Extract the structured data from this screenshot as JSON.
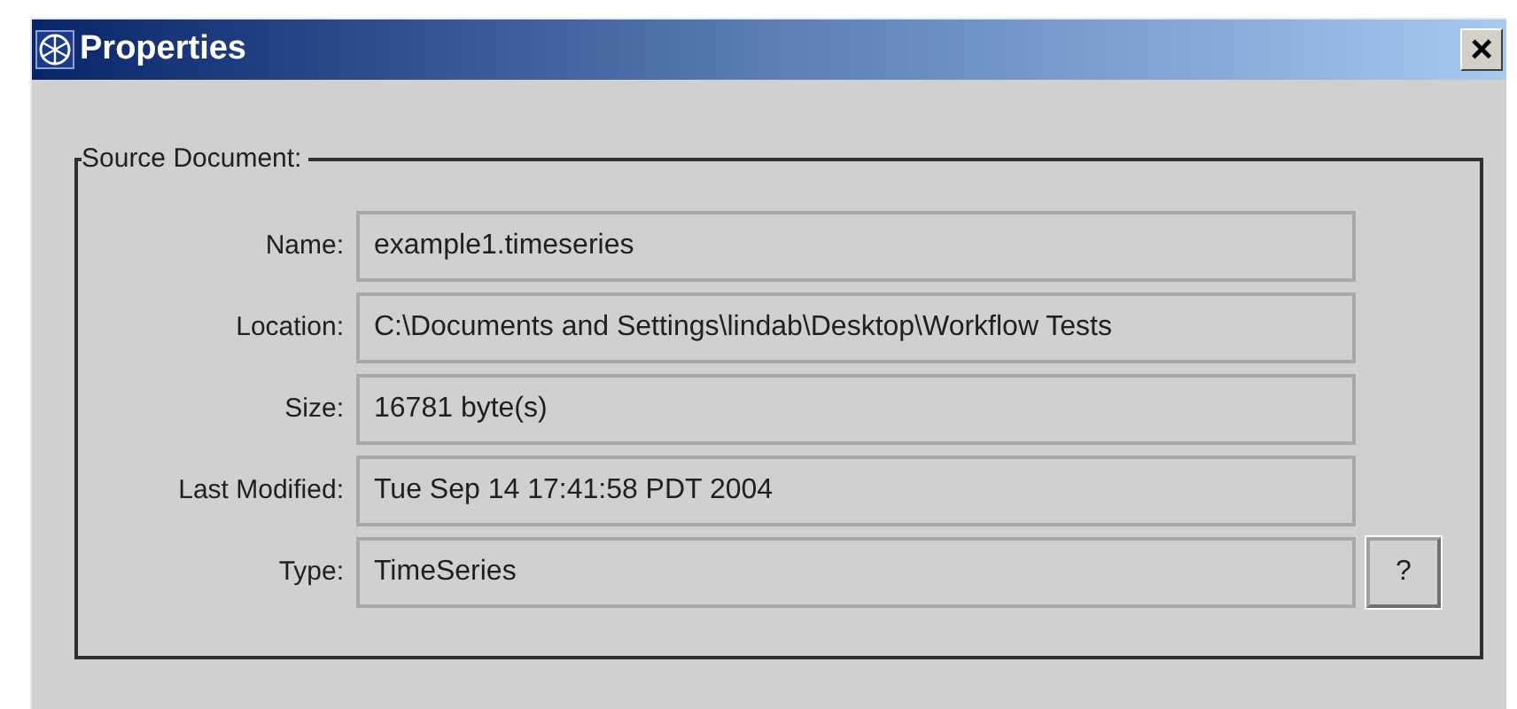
{
  "window": {
    "title": "Properties",
    "close": "×"
  },
  "group": {
    "title": "Source Document:",
    "fields": [
      {
        "label": "Name:",
        "value": "example1.timeseries"
      },
      {
        "label": "Location:",
        "value": "C:\\Documents and Settings\\lindab\\Desktop\\Workflow Tests"
      },
      {
        "label": "Size:",
        "value": "16781 byte(s)"
      },
      {
        "label": "Last Modified:",
        "value": "Tue Sep 14 17:41:58 PDT 2004"
      },
      {
        "label": "Type:",
        "value": "TimeSeries",
        "button": "?"
      }
    ]
  }
}
